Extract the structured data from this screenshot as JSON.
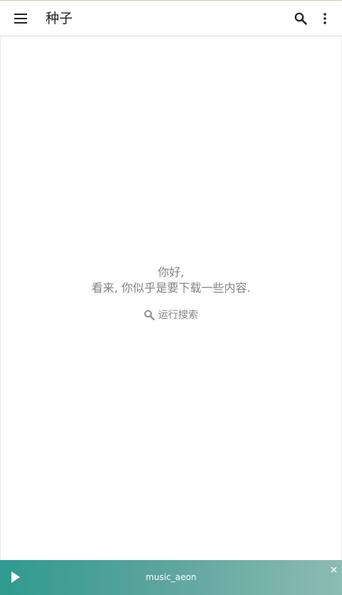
{
  "app_bar": {
    "title": "种子",
    "menu_icon": "menu-icon",
    "search_icon": "search-icon",
    "more_icon": "more-vert-icon"
  },
  "empty_state": {
    "greeting": "你好,",
    "message": "看来, 你似乎是要下载一些内容.",
    "action_label": "运行搜索",
    "action_icon": "search-icon"
  },
  "player": {
    "track": "music_aeon",
    "play_icon": "play-icon",
    "close_icon": "close-icon"
  },
  "colors": {
    "accent": "#2f9a90",
    "text_muted": "#858585",
    "title": "#212121"
  }
}
